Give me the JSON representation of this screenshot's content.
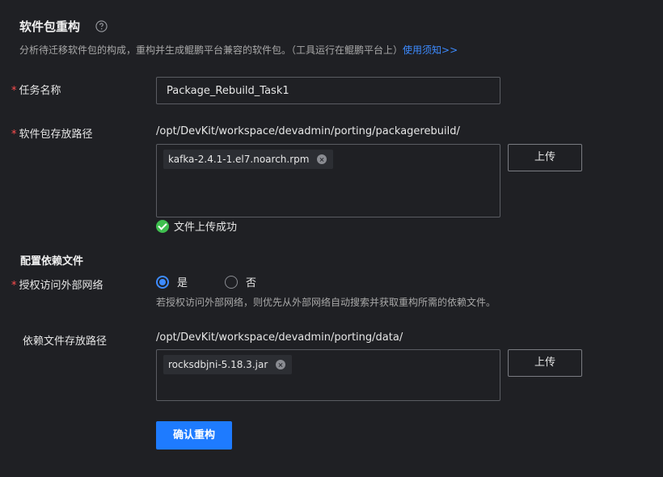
{
  "header": {
    "title": "软件包重构",
    "help_icon": "question-circle-icon",
    "description": "分析待迁移软件包的构成，重构并生成鲲鹏平台兼容的软件包。（工具运行在鲲鹏平台上）",
    "usage_link": "使用须知>>"
  },
  "task": {
    "label": "任务名称",
    "required_mark": "*",
    "value": "Package_Rebuild_Task1"
  },
  "package_path": {
    "label": "软件包存放路径",
    "required_mark": "*",
    "path": "/opt/DevKit/workspace/devadmin/porting/packagerebuild/",
    "file_name": "kafka-2.4.1-1.el7.noarch.rpm",
    "upload_label": "上传",
    "status_text": "文件上传成功"
  },
  "dependency": {
    "section_title": "配置依赖文件",
    "network_label": "授权访问外部网络",
    "required_mark": "*",
    "option_yes": "是",
    "option_no": "否",
    "selected": "是",
    "hint": "若授权访问外部网络，则优先从外部网络自动搜索并获取重构所需的依赖文件。",
    "path_label": "依赖文件存放路径",
    "path": "/opt/DevKit/workspace/devadmin/porting/data/",
    "file_name": "rocksdbjni-5.18.3.jar",
    "upload_label": "上传"
  },
  "actions": {
    "confirm_label": "确认重构"
  },
  "colors": {
    "background": "#1f2024",
    "accent": "#1e7bff",
    "link": "#3d8bff",
    "required": "#ff4d4f",
    "success": "#3fbf4f"
  }
}
